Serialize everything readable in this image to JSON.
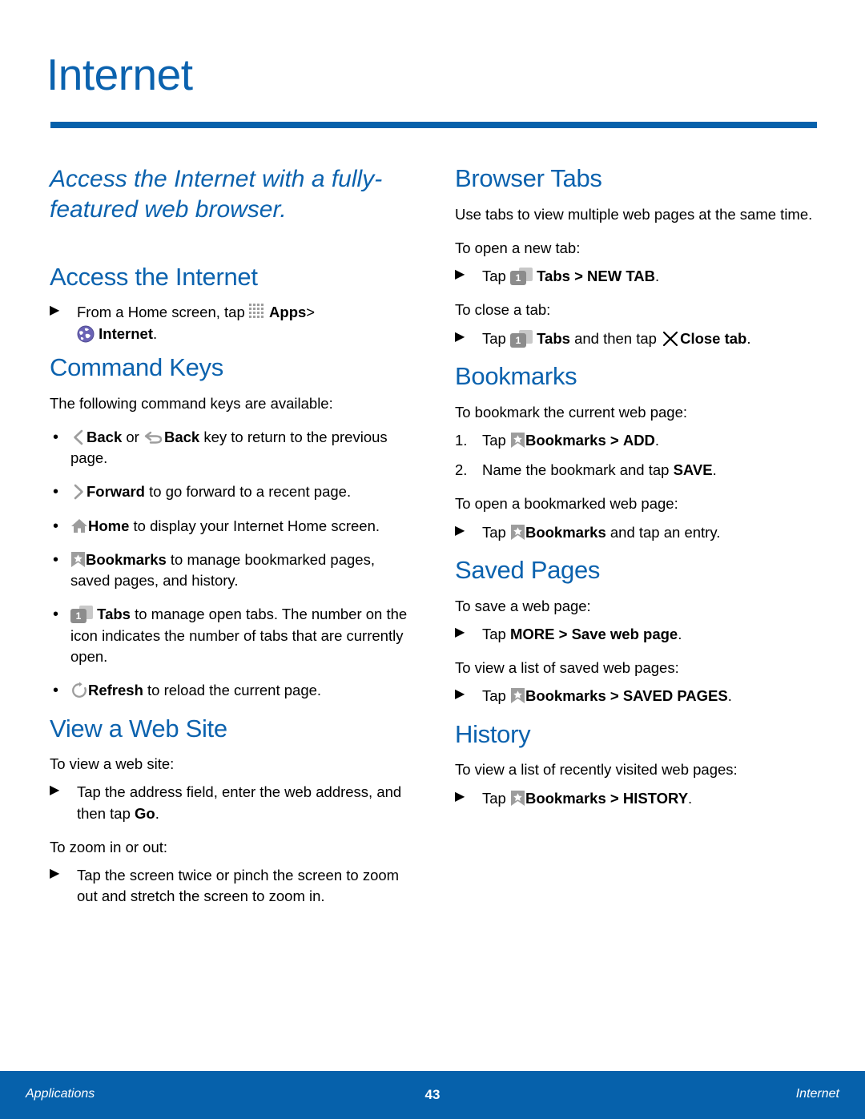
{
  "page": {
    "title": "Internet"
  },
  "lede": "Access the Internet with a fully-featured web browser.",
  "left_column": {
    "access": {
      "heading": "Access the Internet",
      "step_pre": "From a Home screen, tap",
      "apps_label": "Apps",
      "gt": ">",
      "internet_label": "Internet",
      "period": "."
    },
    "command_keys": {
      "heading": "Command Keys",
      "intro": "The following command keys are available:",
      "items": [
        {
          "icons": [
            "chevron-left-icon",
            "back-key-icon"
          ],
          "bold1": "Back",
          "mid": " or ",
          "bold2": "Back",
          "rest": " key to return to the previous page."
        },
        {
          "icons": [
            "chevron-right-icon"
          ],
          "bold1": "Forward",
          "rest": " to go forward to a recent page."
        },
        {
          "icons": [
            "home-icon"
          ],
          "bold1": "Home",
          "rest": " to display your Internet Home screen."
        },
        {
          "icons": [
            "bookmark-icon"
          ],
          "bold1": "Bookmarks",
          "rest": " to manage bookmarked pages, saved pages, and history."
        },
        {
          "icons": [
            "tabs-icon"
          ],
          "bold1": "Tabs",
          "rest": " to manage open tabs. The number on the icon indicates the number of tabs that are currently open."
        },
        {
          "icons": [
            "refresh-icon"
          ],
          "bold1": "Refresh",
          "rest": " to reload the current page."
        }
      ]
    },
    "view_site": {
      "heading": "View a Web Site",
      "intro1": "To view a web site:",
      "step1_pre": "Tap the address field, enter the web address, and then tap ",
      "step1_bold": "Go",
      "step1_post": ".",
      "intro2": "To zoom in or out:",
      "step2": "Tap the screen twice or pinch the screen to zoom out and stretch the screen to zoom in."
    }
  },
  "right_column": {
    "browser_tabs": {
      "heading": "Browser Tabs",
      "intro": "Use tabs to view multiple web pages at the same time.",
      "open_label": "To open a new tab:",
      "open_step_pre": "Tap",
      "open_step_tabs": "Tabs",
      "open_step_gt": ">",
      "open_step_target": "NEW TAB",
      "open_step_end": ".",
      "close_label": "To close a tab:",
      "close_step_pre": "Tap",
      "close_step_tabs": "Tabs",
      "close_step_mid": "and then tap",
      "close_step_target": "Close tab",
      "close_step_end": "."
    },
    "bookmarks": {
      "heading": "Bookmarks",
      "intro": "To bookmark the current web page:",
      "step1_num": "1.",
      "step1_pre": "Tap",
      "step1_bold": "Bookmarks",
      "step1_gt": ">",
      "step1_target": "ADD",
      "step1_end": ".",
      "step2_num": "2.",
      "step2_pre": "Name the bookmark and tap ",
      "step2_bold": "SAVE",
      "step2_end": ".",
      "open_label": "To open a bookmarked web page:",
      "open_pre": "Tap",
      "open_bold": "Bookmarks",
      "open_rest": "and tap an entry."
    },
    "saved_pages": {
      "heading": "Saved Pages",
      "save_label": "To save a web page:",
      "save_pre": "Tap ",
      "save_bold1": "MORE",
      "save_gt": " > ",
      "save_bold2": "Save web page",
      "save_end": ".",
      "view_label": "To view a list of saved web pages:",
      "view_pre": "Tap",
      "view_bold": "Bookmarks",
      "view_gt": ">",
      "view_target": "SAVED PAGES",
      "view_end": "."
    },
    "history": {
      "heading": "History",
      "intro": "To view a list of recently visited web pages:",
      "step_pre": "Tap",
      "step_bold": "Bookmarks",
      "step_gt": ">",
      "step_target": "HISTORY",
      "step_end": "."
    }
  },
  "markers": {
    "triangle": "▶",
    "bullet": "•"
  },
  "footer": {
    "left": "Applications",
    "page_number": "43",
    "right": "Internet"
  },
  "colors": {
    "brand_blue": "#0661ab",
    "heading_blue": "#0b62ae",
    "icon_gray": "#9d9d9d",
    "globe_purple": "#6a63b5"
  }
}
